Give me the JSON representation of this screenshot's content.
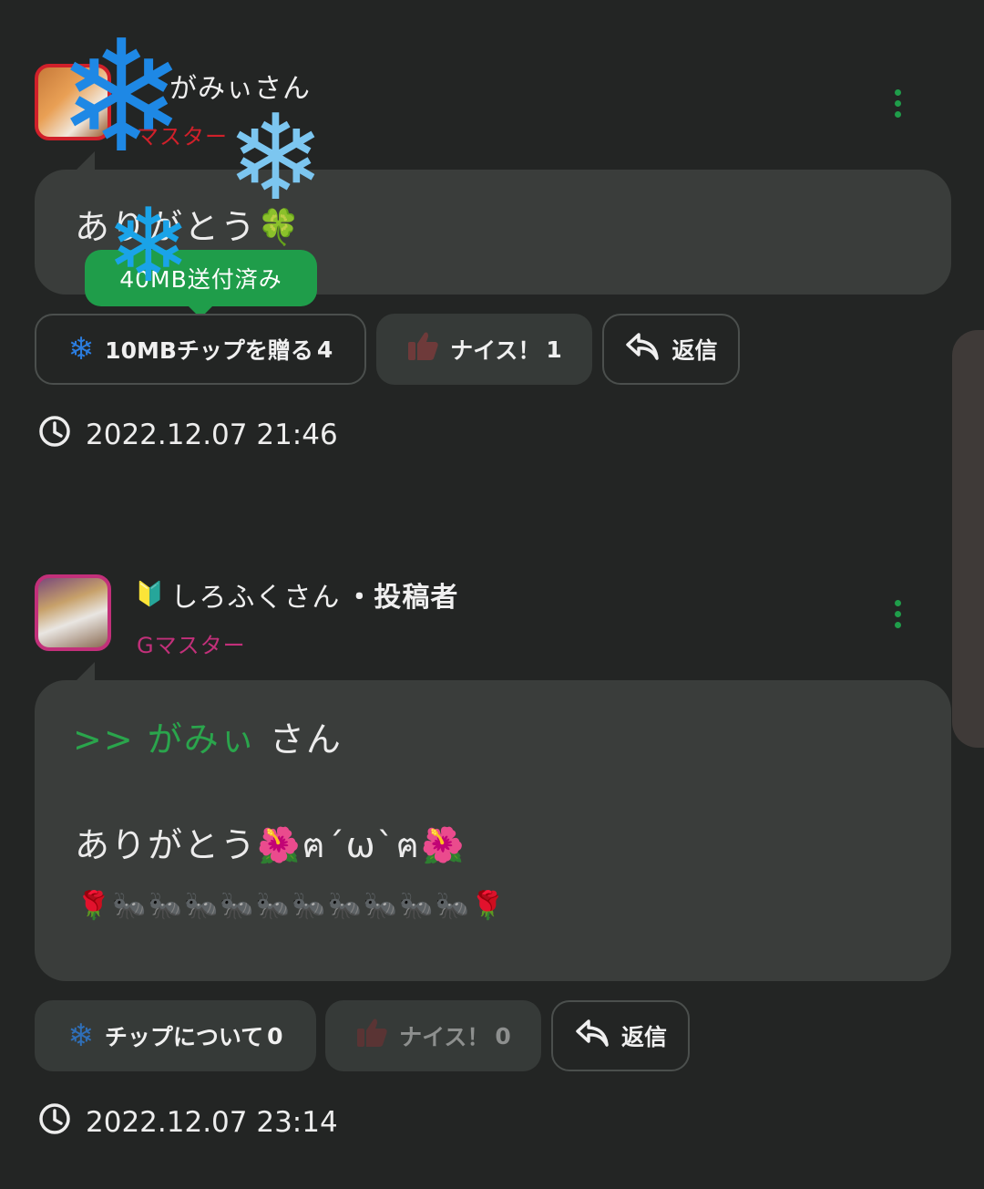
{
  "colors": {
    "background": "#232524",
    "bubble": "#3a3d3b",
    "accent_green": "#1f9d4a",
    "rank_red": "#d0202a",
    "rank_pink": "#c2307a"
  },
  "comments": [
    {
      "username": "がみぃさん",
      "rank": "マスター",
      "message": "ありがとう🍀",
      "tooltip": "40MB送付済み",
      "tip_button_label": "10MBチップを贈る",
      "tip_count": "4",
      "nice_label": "ナイス！",
      "nice_count": "1",
      "reply_label": "返信",
      "timestamp": "2022.12.07 21:46"
    },
    {
      "beginner_icon": "🔰",
      "username": "しろふくさん",
      "poster_tag": "・投稿者",
      "rank": "Gマスター",
      "mention_prefix": ">>",
      "mention_name": "がみぃ",
      "mention_suffix": "さん",
      "message_line1": "ありがとう🌺ฅ´ω`ฅ🌺",
      "message_line2": "🌹🐜🐜🐜🐜🐜🐜🐜🐜🐜🐜🌹",
      "tip_button_label": "チップについて",
      "tip_count": "0",
      "nice_label": "ナイス！",
      "nice_count": "0",
      "reply_label": "返信",
      "timestamp": "2022.12.07 23:14"
    }
  ],
  "icons": [
    "snowflake-icon",
    "thumbs-up-icon",
    "reply-icon",
    "clock-icon",
    "kebab-menu-icon",
    "beginner-mark-icon"
  ]
}
